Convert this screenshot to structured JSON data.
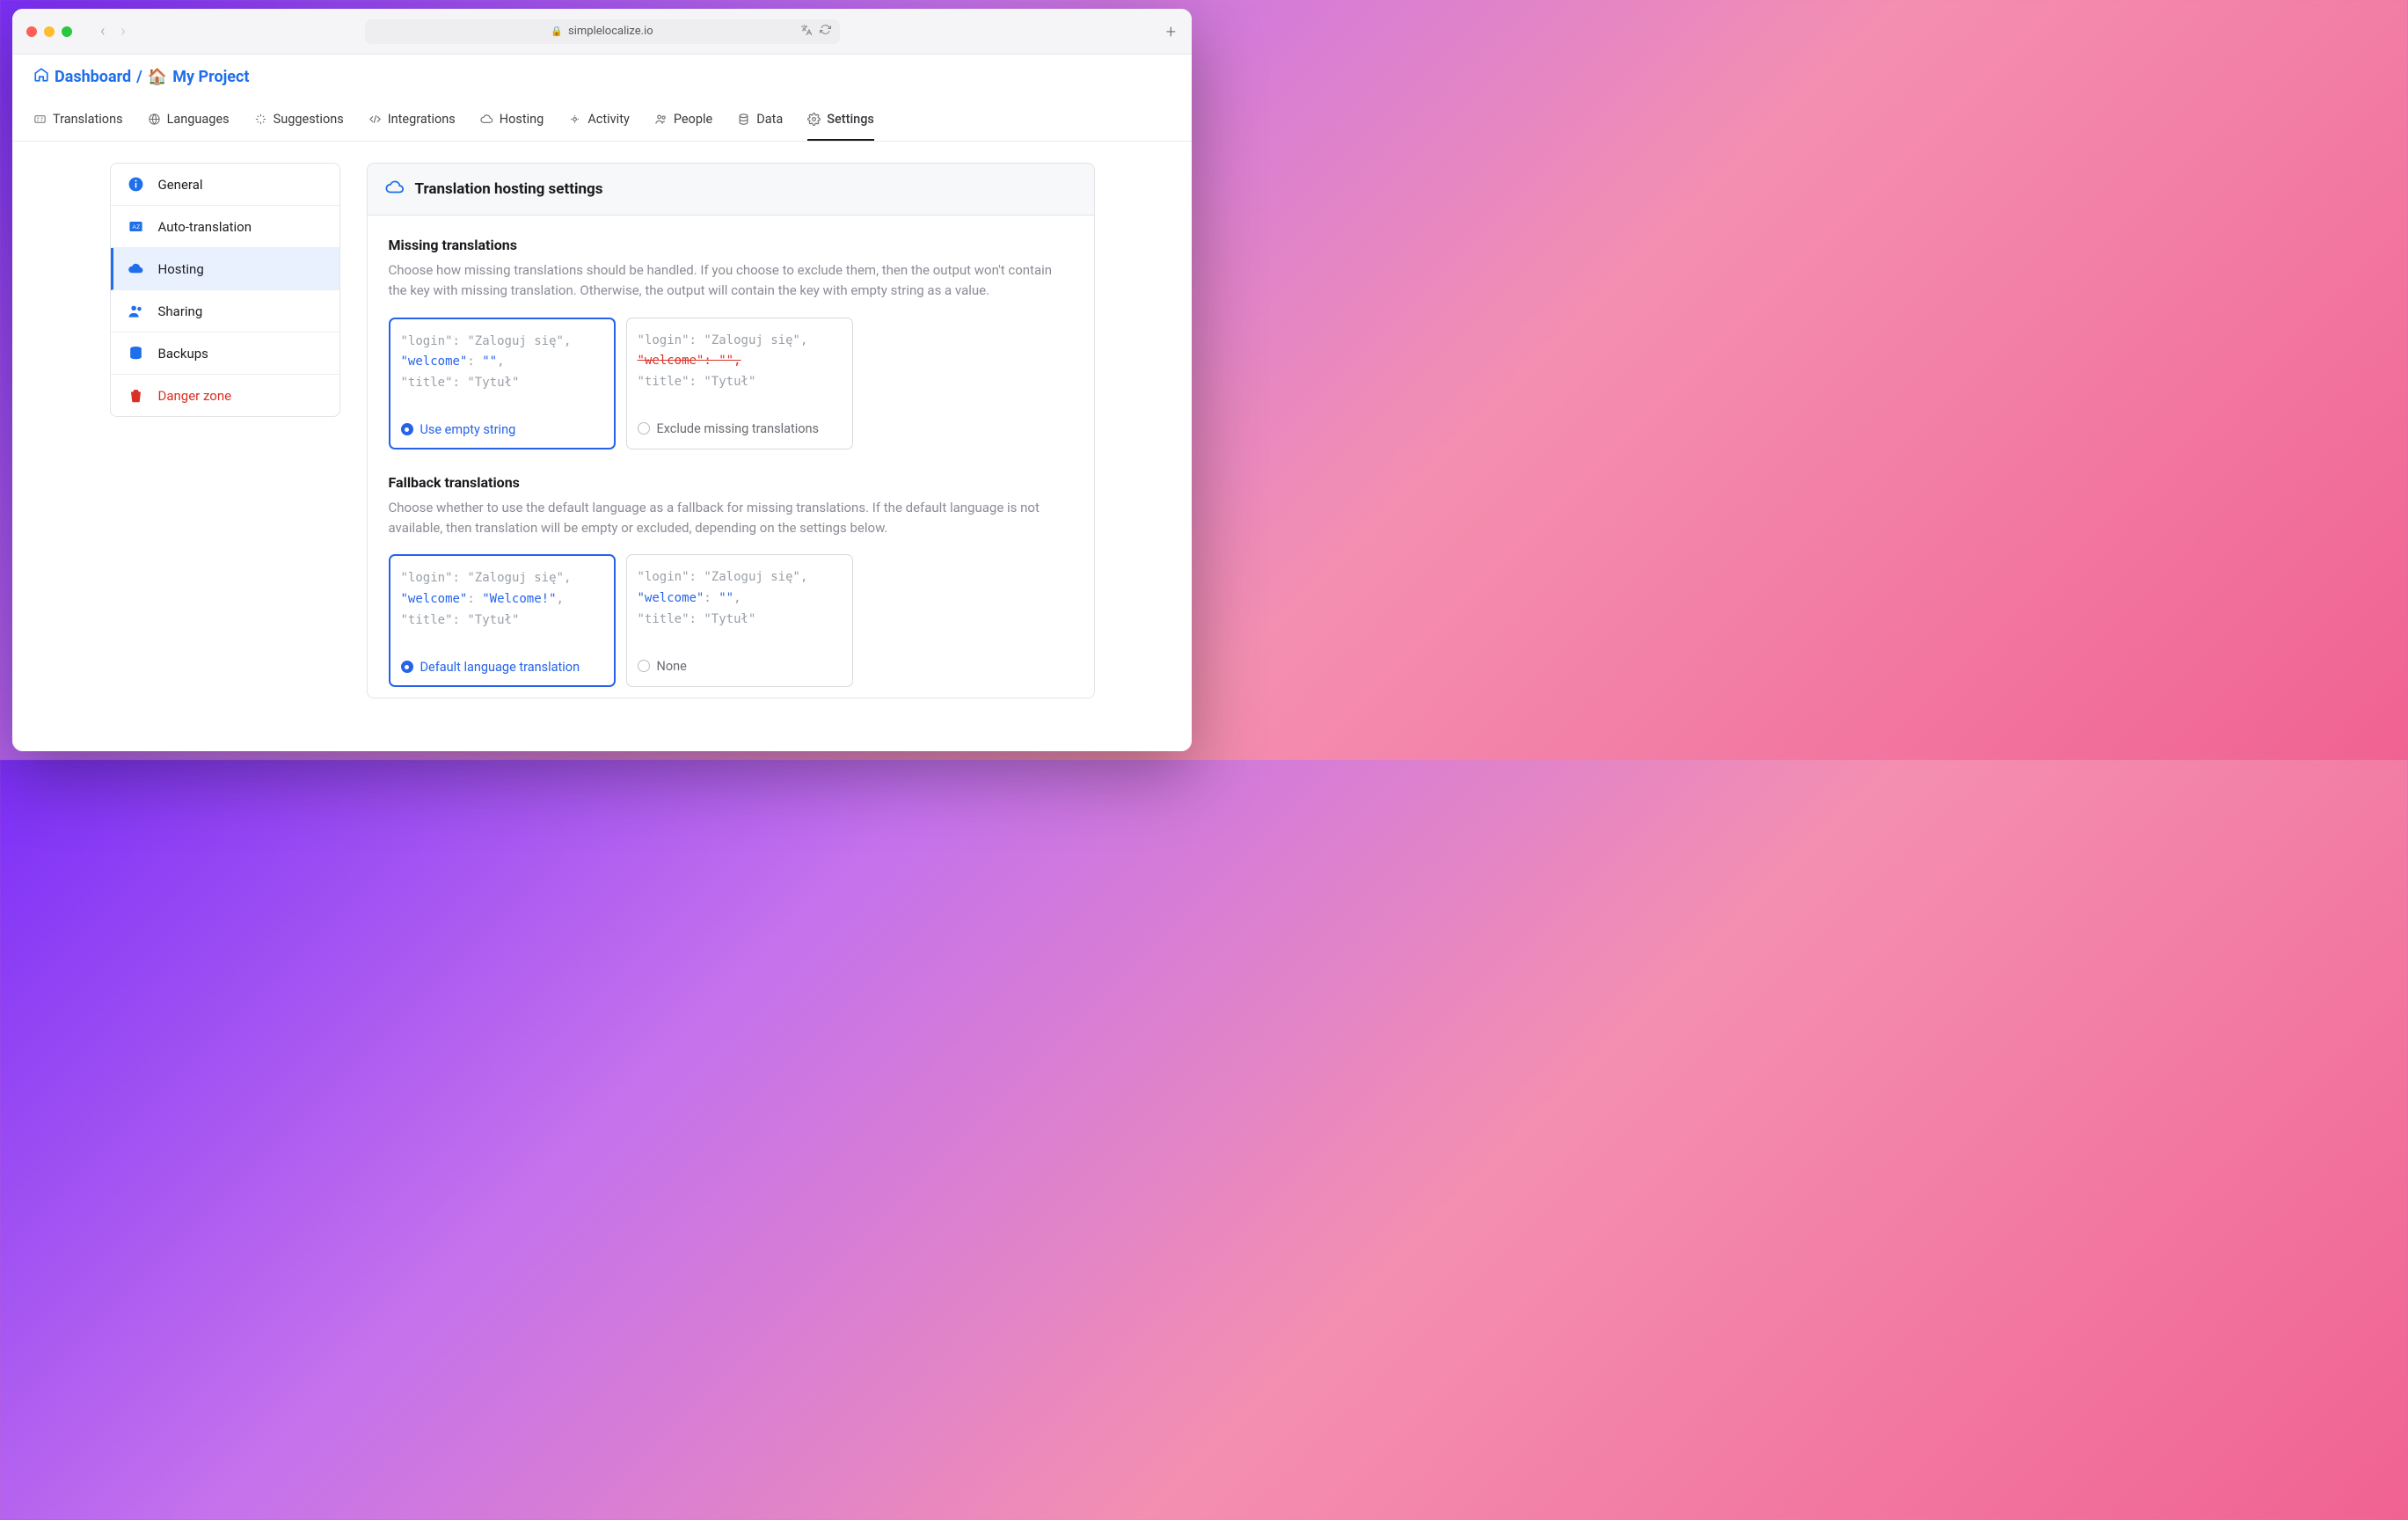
{
  "browser": {
    "url_host": "simplelocalize.io"
  },
  "breadcrumb": {
    "dashboard": "Dashboard",
    "project": "My Project",
    "project_emoji": "🏠"
  },
  "tabs": [
    {
      "label": "Translations"
    },
    {
      "label": "Languages"
    },
    {
      "label": "Suggestions"
    },
    {
      "label": "Integrations"
    },
    {
      "label": "Hosting"
    },
    {
      "label": "Activity"
    },
    {
      "label": "People"
    },
    {
      "label": "Data"
    },
    {
      "label": "Settings"
    }
  ],
  "sidebar": {
    "items": [
      {
        "label": "General"
      },
      {
        "label": "Auto-translation"
      },
      {
        "label": "Hosting"
      },
      {
        "label": "Sharing"
      },
      {
        "label": "Backups"
      },
      {
        "label": "Danger zone"
      }
    ]
  },
  "panel": {
    "title": "Translation hosting settings"
  },
  "missing": {
    "title": "Missing translations",
    "desc": "Choose how missing translations should be handled. If you choose to exclude them, then the output won't contain the key with missing translation. Otherwise, the output will contain the key with empty string as a value.",
    "opt1_label": "Use empty string",
    "opt2_label": "Exclude missing translations",
    "code": {
      "line1_key": "\"login\"",
      "line1_val": "\"Zaloguj się\"",
      "line2_key": "\"welcome\"",
      "line2_val": "\"\"",
      "line3_key": "\"title\"",
      "line3_val": "\"Tytuł\""
    }
  },
  "fallback": {
    "title": "Fallback translations",
    "desc": "Choose whether to use the default language as a fallback for missing translations. If the default language is not available, then translation will be empty or excluded, depending on the settings below.",
    "opt1_label": "Default language translation",
    "opt2_label": "None",
    "code": {
      "line1_key": "\"login\"",
      "line1_val": "\"Zaloguj się\"",
      "line2a_key": "\"welcome\"",
      "line2a_val": "\"Welcome!\"",
      "line2b_key": "\"welcome\"",
      "line2b_val": "\"\"",
      "line3_key": "\"title\"",
      "line3_val": "\"Tytuł\""
    }
  }
}
